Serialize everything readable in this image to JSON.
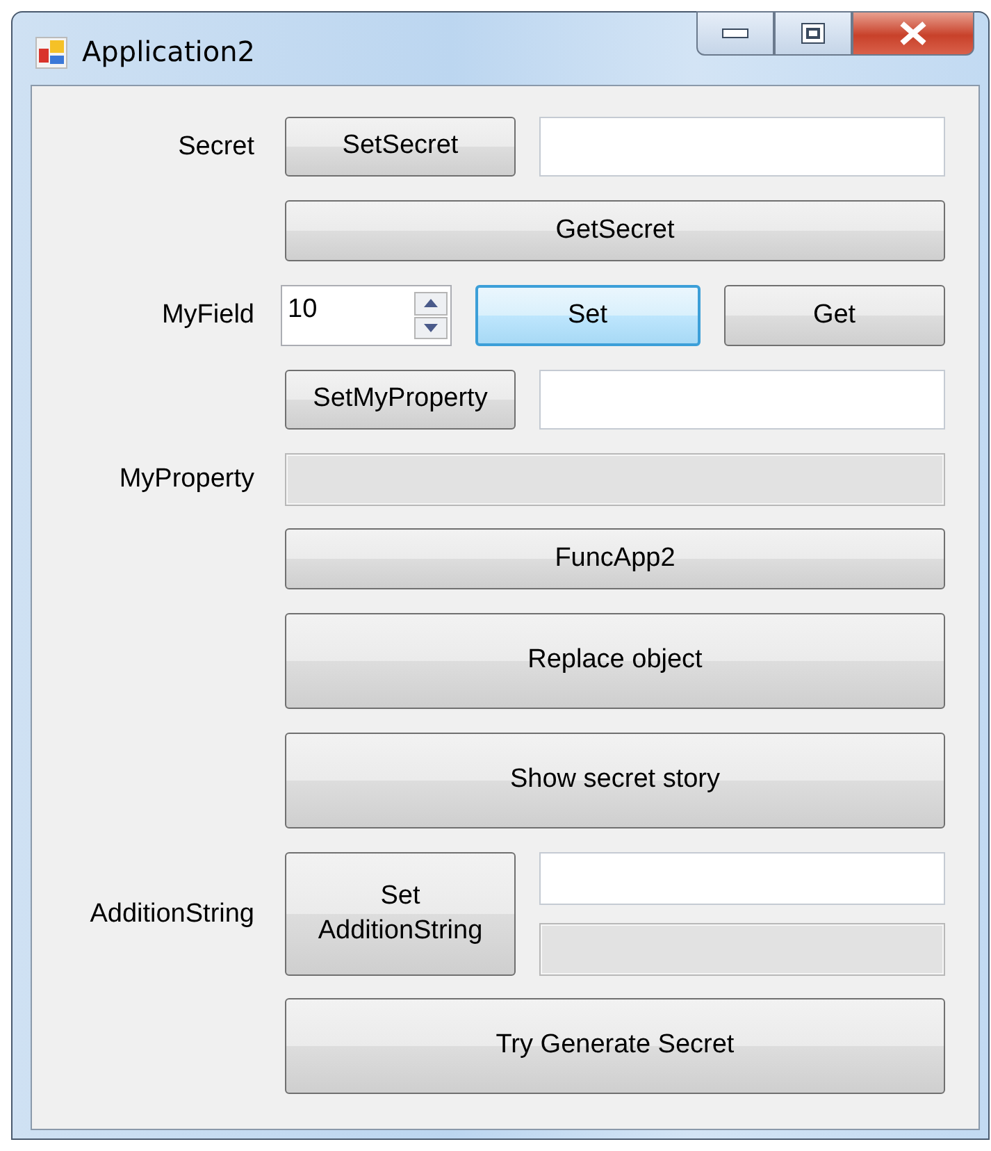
{
  "window": {
    "title": "Application2"
  },
  "rows": [
    {
      "kind": "button-field",
      "label": "Secret",
      "button": {
        "label": "SetSecret",
        "focused": false
      },
      "field": {
        "disabled": false
      }
    },
    {
      "kind": "wide-button",
      "button": {
        "label": "GetSecret",
        "focused": false
      }
    },
    {
      "kind": "spinner",
      "label": "MyField",
      "spinner": {
        "value": "10"
      },
      "buttons": [
        {
          "label": "Set",
          "focused": true
        },
        {
          "label": "Get",
          "focused": false
        }
      ]
    },
    {
      "kind": "button-field",
      "button": {
        "label": "SetMyProperty",
        "focused": false
      },
      "field": {
        "disabled": false
      }
    },
    {
      "kind": "field",
      "label": "MyProperty",
      "field": {
        "disabled": true
      }
    },
    {
      "kind": "wide-button",
      "button": {
        "label": "FuncApp2",
        "focused": false
      }
    },
    {
      "kind": "tall-button",
      "button": {
        "label": "Replace object",
        "focused": false
      }
    },
    {
      "kind": "tall-button",
      "button": {
        "label": "Show secret story",
        "focused": false
      }
    },
    {
      "kind": "button-two-fields",
      "label": "AdditionString",
      "button": {
        "label": "Set\nAdditionString",
        "focused": false
      },
      "fields": [
        {
          "disabled": false
        },
        {
          "disabled": true
        }
      ]
    },
    {
      "kind": "tall-button",
      "button": {
        "label": "Try Generate Secret",
        "focused": false
      }
    }
  ]
}
